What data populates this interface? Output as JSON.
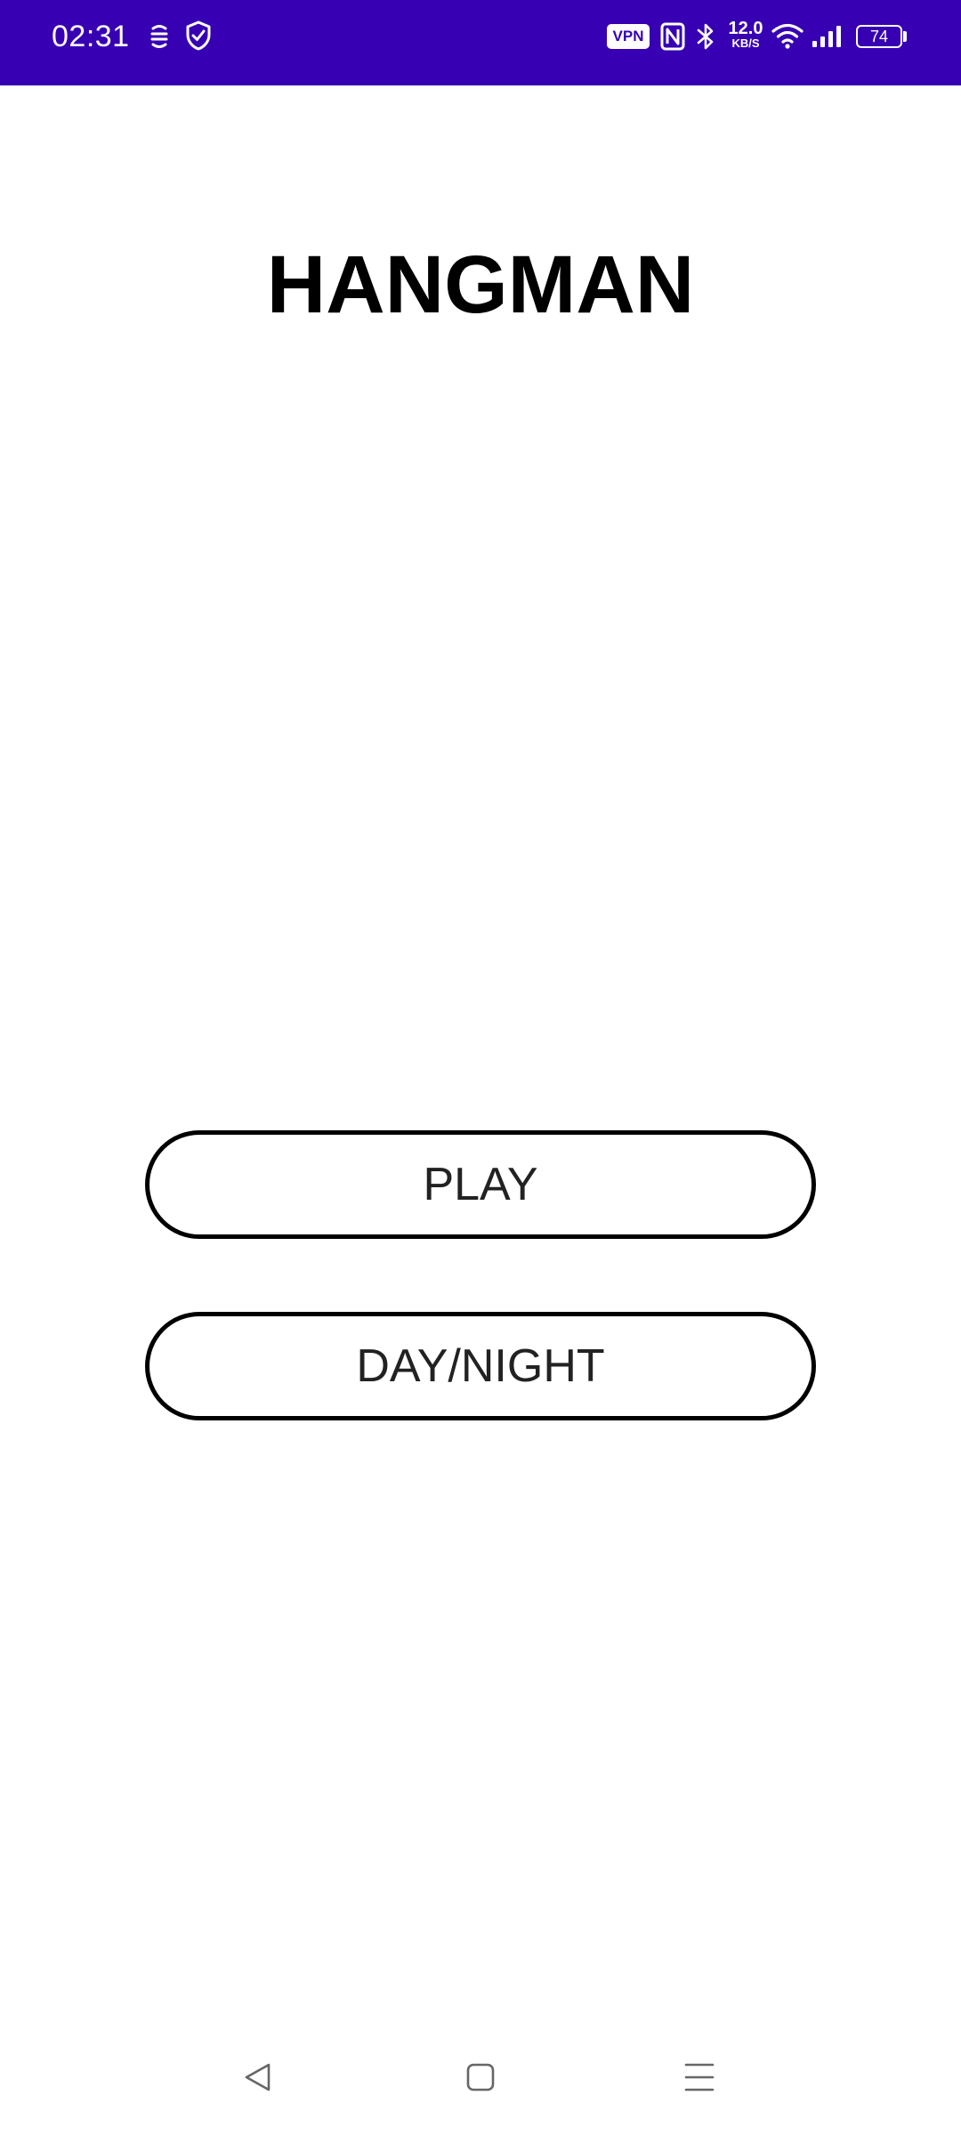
{
  "status_bar": {
    "time": "02:31",
    "background_color": "#3700b3",
    "icons_left": [
      "vpn-key-icon",
      "shield-check-icon"
    ],
    "vpn_label": "VPN",
    "icons_right": [
      "nfc-icon",
      "bluetooth-icon",
      "wifi-icon",
      "signal-icon"
    ],
    "net_speed_value": "12.0",
    "net_speed_unit": "KB/S",
    "battery_level": "74"
  },
  "main": {
    "title": "HANGMAN",
    "play_label": "PLAY",
    "daynight_label": "DAY/NIGHT"
  },
  "nav_bar": {
    "icons": [
      "back-icon",
      "home-icon",
      "menu-icon"
    ]
  }
}
